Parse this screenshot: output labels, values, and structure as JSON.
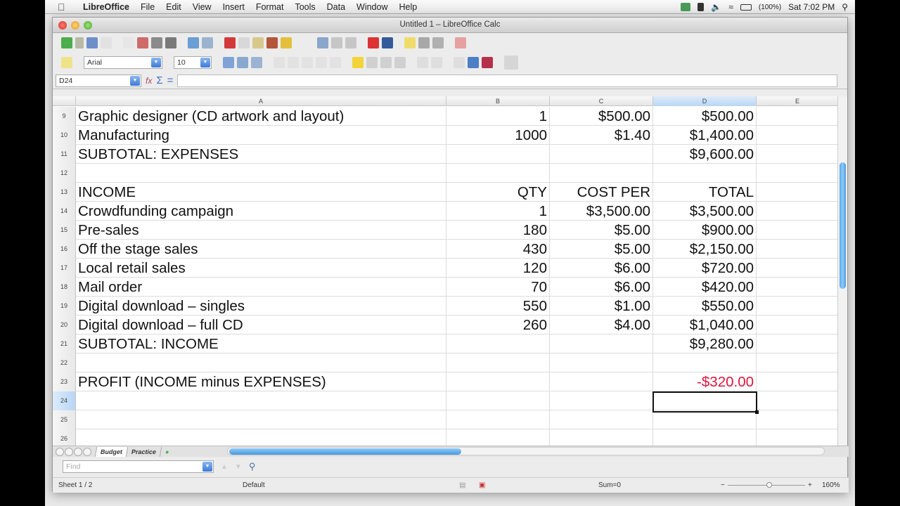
{
  "menubar": {
    "app_name": "LibreOffice",
    "items": [
      "File",
      "Edit",
      "View",
      "Insert",
      "Format",
      "Tools",
      "Data",
      "Window",
      "Help"
    ],
    "battery": "(100%)",
    "clock": "Sat 7:02 PM"
  },
  "window": {
    "title": "Untitled 1 – LibreOffice Calc"
  },
  "format_toolbar": {
    "font_name": "Arial",
    "font_size": "10"
  },
  "formula_bar": {
    "name_box": "D24",
    "formula": ""
  },
  "columns": [
    "A",
    "B",
    "C",
    "D",
    "E"
  ],
  "selected_column": "D",
  "selected_row": "24",
  "rows": [
    {
      "num": "9",
      "A": "Graphic designer (CD artwork and layout)",
      "B": "1",
      "C": "$500.00",
      "D": "$500.00"
    },
    {
      "num": "10",
      "A": "Manufacturing",
      "B": "1000",
      "C": "$1.40",
      "D": "$1,400.00"
    },
    {
      "num": "11",
      "A": "SUBTOTAL: EXPENSES",
      "B": "",
      "C": "",
      "D": "$9,600.00"
    },
    {
      "num": "12",
      "A": "",
      "B": "",
      "C": "",
      "D": ""
    },
    {
      "num": "13",
      "A": "INCOME",
      "B": "QTY",
      "C": "COST PER",
      "D": "TOTAL"
    },
    {
      "num": "14",
      "A": "Crowdfunding campaign",
      "B": "1",
      "C": "$3,500.00",
      "D": "$3,500.00"
    },
    {
      "num": "15",
      "A": "Pre-sales",
      "B": "180",
      "C": "$5.00",
      "D": "$900.00"
    },
    {
      "num": "16",
      "A": "Off the stage sales",
      "B": "430",
      "C": "$5.00",
      "D": "$2,150.00"
    },
    {
      "num": "17",
      "A": "Local retail sales",
      "B": "120",
      "C": "$6.00",
      "D": "$720.00"
    },
    {
      "num": "18",
      "A": "Mail order",
      "B": "70",
      "C": "$6.00",
      "D": "$420.00"
    },
    {
      "num": "19",
      "A": "Digital download – singles",
      "B": "550",
      "C": "$1.00",
      "D": "$550.00"
    },
    {
      "num": "20",
      "A": "Digital download – full CD",
      "B": "260",
      "C": "$4.00",
      "D": "$1,040.00"
    },
    {
      "num": "21",
      "A": "SUBTOTAL: INCOME",
      "B": "",
      "C": "",
      "D": "$9,280.00"
    },
    {
      "num": "22",
      "A": "",
      "B": "",
      "C": "",
      "D": ""
    },
    {
      "num": "23",
      "A": "PROFIT (INCOME minus EXPENSES)",
      "B": "",
      "C": "",
      "D": "-$320.00"
    },
    {
      "num": "24",
      "A": "",
      "B": "",
      "C": "",
      "D": ""
    },
    {
      "num": "25",
      "A": "",
      "B": "",
      "C": "",
      "D": ""
    },
    {
      "num": "26",
      "A": "",
      "B": "",
      "C": "",
      "D": ""
    }
  ],
  "negative_color": "#e0143c",
  "sheet_tabs": [
    "Budget",
    "Practice"
  ],
  "active_sheet": "Budget",
  "find": {
    "placeholder": "Find"
  },
  "status": {
    "sheet": "Sheet 1 / 2",
    "page_style": "Default",
    "sum": "Sum=0",
    "zoom": "160%"
  }
}
